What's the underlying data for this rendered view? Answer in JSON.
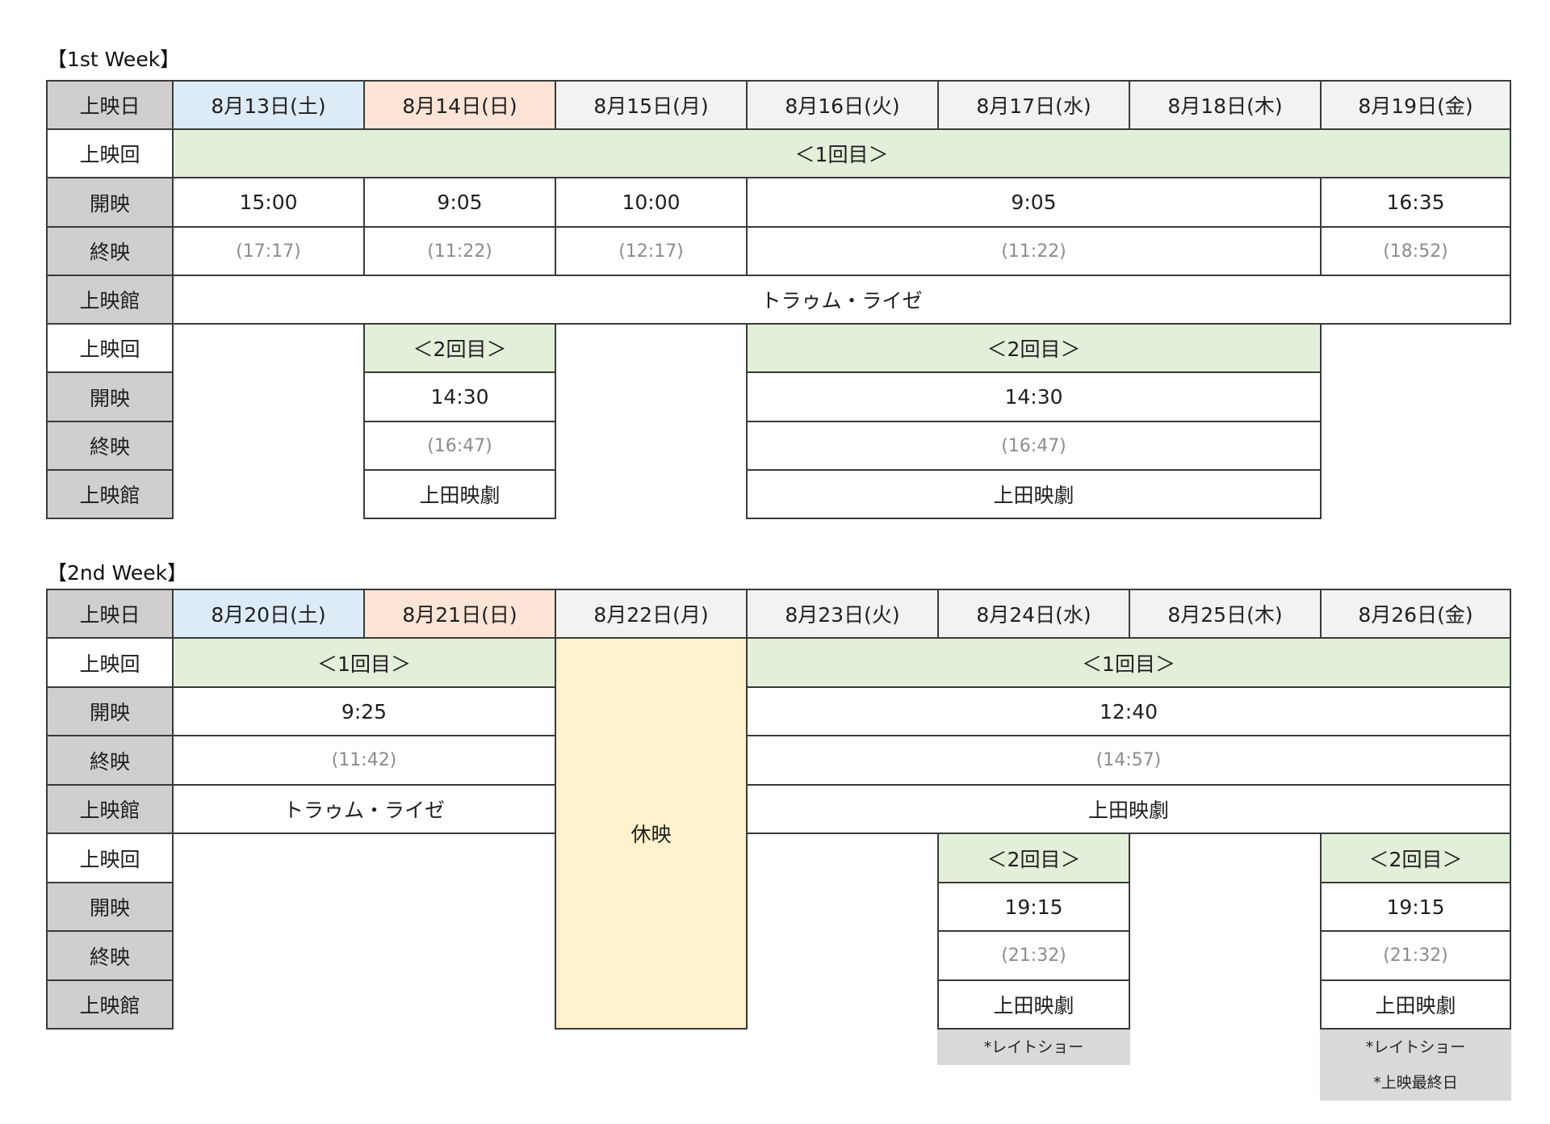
{
  "labels": {
    "date": "上映日",
    "round": "上映回",
    "start": "開映",
    "end": "終映",
    "venue": "上映館"
  },
  "week1": {
    "title": "【1st Week】",
    "dates": [
      "8月13日(土)",
      "8月14日(日)",
      "8月15日(月)",
      "8月16日(火)",
      "8月17日(水)",
      "8月18日(木)",
      "8月19日(金)"
    ],
    "r1": {
      "round": "＜1回目＞",
      "starts": [
        "15:00",
        "9:05",
        "10:00",
        "9:05",
        "16:35"
      ],
      "ends": [
        "(17:17)",
        "(11:22)",
        "(12:17)",
        "(11:22)",
        "(18:52)"
      ],
      "venue": "トラゥム・ライゼ"
    },
    "r2a": {
      "round": "＜2回目＞",
      "start": "14:30",
      "end": "(16:47)",
      "venue": "上田映劇"
    },
    "r2b": {
      "round": "＜2回目＞",
      "start": "14:30",
      "end": "(16:47)",
      "venue": "上田映劇"
    }
  },
  "week2": {
    "title": "【2nd Week】",
    "dates": [
      "8月20日(土)",
      "8月21日(日)",
      "8月22日(月)",
      "8月23日(火)",
      "8月24日(水)",
      "8月25日(木)",
      "8月26日(金)"
    ],
    "r1a": {
      "round": "＜1回目＞",
      "start": "9:25",
      "end": "(11:42)",
      "venue": "トラゥム・ライゼ"
    },
    "closed": "休映",
    "r1b": {
      "round": "＜1回目＞",
      "start": "12:40",
      "end": "(14:57)",
      "venue": "上田映劇"
    },
    "r2a": {
      "round": "＜2回目＞",
      "start": "19:15",
      "end": "(21:32)",
      "venue": "上田映劇",
      "note": "*レイトショー"
    },
    "r2b": {
      "round": "＜2回目＞",
      "start": "19:15",
      "end": "(21:32)",
      "venue": "上田映劇",
      "note1": "*レイトショー",
      "note2": "*上映最終日"
    }
  },
  "colors": {
    "header_gray": "#d0cece",
    "saturday_blue": "#ddebf7",
    "sunday_peach": "#fce4d6",
    "weekday_gray": "#f2f2f2",
    "round_green": "#e2efda",
    "closed_yellow": "#fff2cc",
    "note_gray": "#d9d9d9"
  }
}
